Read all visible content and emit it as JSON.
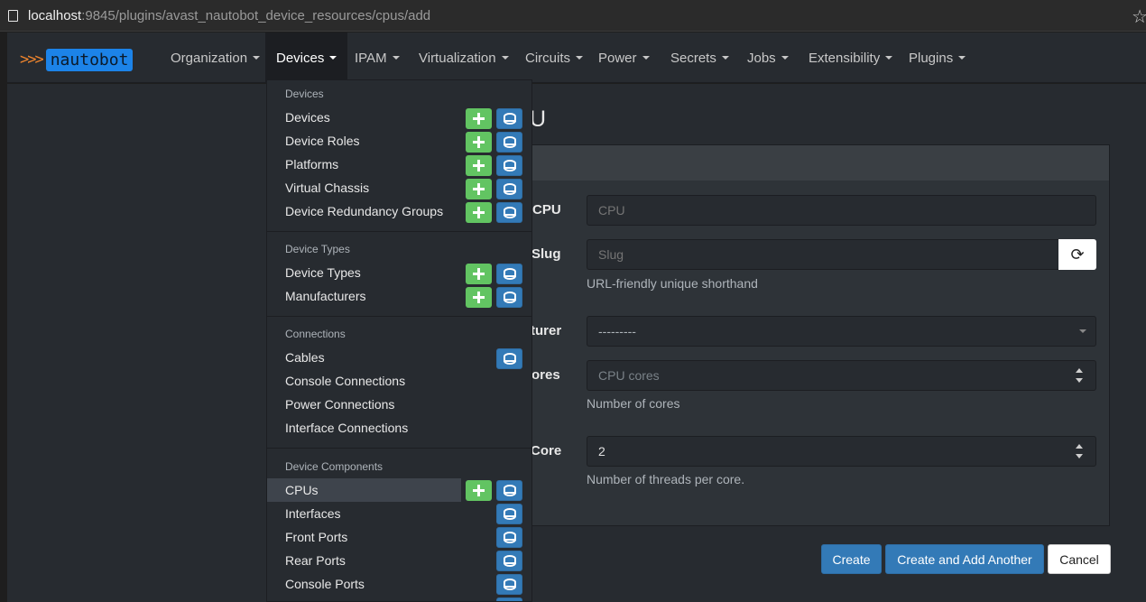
{
  "browser": {
    "url_host": "localhost",
    "url_rest": ":9845/plugins/avast_nautobot_device_resources/cpus/add",
    "bookmark_icon": "star-icon"
  },
  "brand": {
    "chevrons": ">>>",
    "name": "nautobot",
    "accent": "#1c83e8"
  },
  "nav": [
    {
      "label": "Organization"
    },
    {
      "label": "Devices"
    },
    {
      "label": "IPAM"
    },
    {
      "label": "Virtualization"
    },
    {
      "label": "Circuits"
    },
    {
      "label": "Power"
    },
    {
      "label": "Secrets"
    },
    {
      "label": "Jobs"
    },
    {
      "label": "Extensibility"
    },
    {
      "label": "Plugins"
    }
  ],
  "page": {
    "title_visible": "U",
    "fields": {
      "cpu": {
        "label": "CPU",
        "placeholder": "CPU"
      },
      "slug": {
        "label": "Slug",
        "placeholder": "Slug",
        "help": "URL-friendly unique shorthand"
      },
      "manufacturer": {
        "label": "turer",
        "value": "---------"
      },
      "cores": {
        "label": "ores",
        "placeholder": "CPU cores",
        "help": "Number of cores"
      },
      "threads": {
        "label": "Core",
        "value": "2",
        "help": "Number of threads per core."
      }
    },
    "buttons": {
      "create": "Create",
      "create_another": "Create and Add Another",
      "cancel": "Cancel"
    }
  },
  "dropdown": {
    "sections": [
      {
        "header": "Devices",
        "items": [
          "Devices",
          "Device Roles",
          "Platforms",
          "Virtual Chassis",
          "Device Redundancy Groups"
        ]
      },
      {
        "header": "Device Types",
        "items": [
          "Device Types",
          "Manufacturers"
        ]
      },
      {
        "header": "Connections",
        "items": [
          "Cables",
          "Console Connections",
          "Power Connections",
          "Interface Connections"
        ]
      },
      {
        "header": "Device Components",
        "items": [
          "CPUs",
          "Interfaces",
          "Front Ports",
          "Rear Ports",
          "Console Ports"
        ]
      }
    ],
    "active_item": "CPUs"
  },
  "colors": {
    "add": "#62c462",
    "list": "#337ab7",
    "primary": "#337ab7"
  }
}
